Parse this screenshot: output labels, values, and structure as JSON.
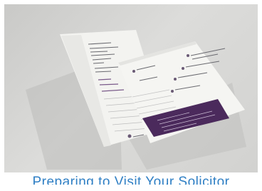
{
  "caption": {
    "text": "Preparing to Visit Your Solicitor"
  },
  "colors": {
    "caption": "#2f7fc4",
    "accent": "#4b2a5c",
    "paper": "#f1f1ee",
    "background": "#d4d4d2"
  },
  "image": {
    "icon": "brochure-mockup-image"
  }
}
